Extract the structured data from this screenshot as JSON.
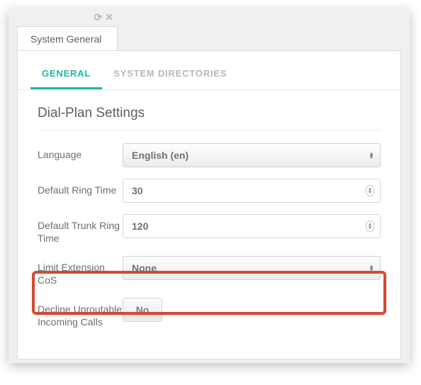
{
  "window": {
    "title": "System General"
  },
  "tabs": {
    "general": "GENERAL",
    "system_directories": "SYSTEM DIRECTORIES"
  },
  "section": {
    "title": "Dial-Plan Settings"
  },
  "fields": {
    "language": {
      "label": "Language",
      "value": "English (en)"
    },
    "default_ring_time": {
      "label": "Default Ring Time",
      "value": "30"
    },
    "default_trunk_ring_time": {
      "label": "Default Trunk Ring Time",
      "value": "120"
    },
    "limit_extension_cos": {
      "label": "Limit Extension CoS",
      "value": "None"
    },
    "decline_unroutable": {
      "label": "Decline Unroutable Incoming Calls",
      "value": "No"
    }
  }
}
